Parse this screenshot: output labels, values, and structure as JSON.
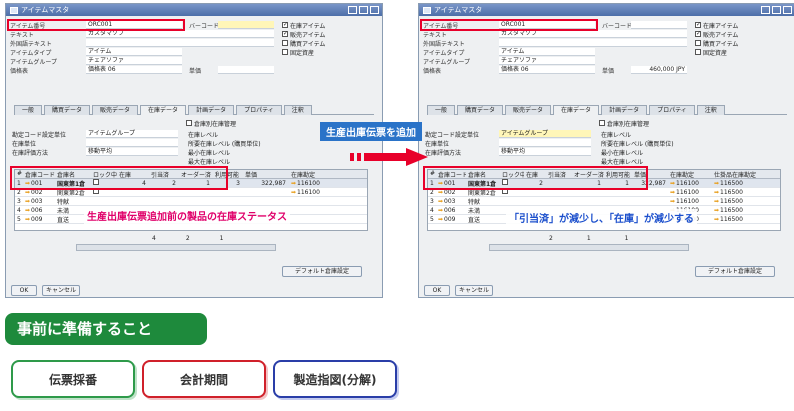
{
  "window_title": "アイテムマスタ",
  "fields": {
    "item_no_label": "アイテム番号",
    "item_no_value": "ORC001",
    "desc_label": "テキスト",
    "desc_value": "カスタマソフ",
    "foreign_label": "外国語テキスト",
    "type_label": "アイテムタイプ",
    "type_value": "アイテム",
    "group_label": "アイテムグループ",
    "group_value": "チェアソファ",
    "price_label": "価格表",
    "price_value": "価格表 06",
    "unit_price_label": "単価",
    "unit_price_value_right": "460,000 JPY",
    "barcode_label": "バーコード"
  },
  "checks": [
    "在庫アイテム",
    "販売アイテム",
    "購買アイテム",
    "固定資産"
  ],
  "tabs": [
    "一般",
    "購買データ",
    "販売データ",
    "在庫データ",
    "計画データ",
    "プロパティ",
    "注釈"
  ],
  "inventory": {
    "warehouse_mgmt": "倉庫別在庫管理",
    "method_label": "勘定コード設定単位",
    "method_value": "アイテムグループ",
    "unit_label": "在庫単位",
    "valuation_label": "在庫評価方法",
    "valuation_value": "移動平均",
    "stock_level": "在庫レベル",
    "required_level": "所要在庫レベル (購買単位)",
    "min_level": "最小在庫レベル",
    "max_level": "最大在庫レベル"
  },
  "grid_left": {
    "headers": [
      "#",
      "倉庫コード",
      "倉庫名",
      "ロック中",
      "在庫",
      "引当済",
      "オーダー済",
      "利用可能",
      "",
      "単価",
      "在庫勘定"
    ],
    "rows": [
      [
        "1",
        "001",
        "国東第1倉",
        "",
        "4",
        "2",
        "1",
        "3",
        "",
        "322,987",
        "116100"
      ],
      [
        "2",
        "002",
        "関東第2倉",
        "",
        "",
        "",
        "",
        "",
        "",
        "",
        "116100"
      ],
      [
        "3",
        "003",
        "特献",
        "",
        "",
        "",
        "",
        "",
        "",
        "",
        ""
      ],
      [
        "4",
        "006",
        "未満",
        "",
        "",
        "",
        "",
        "",
        "",
        "",
        ""
      ],
      [
        "5",
        "009",
        "直送",
        "",
        "",
        "",
        "",
        "",
        "",
        "",
        ""
      ]
    ],
    "footer_values": [
      "4",
      "2",
      "1"
    ]
  },
  "grid_right": {
    "headers": [
      "#",
      "倉庫コード",
      "倉庫名",
      "ロック中",
      "在庫",
      "引当済",
      "オーダー済",
      "利用可能",
      "単価",
      "在庫勘定",
      "仕掛品在庫勘定"
    ],
    "rows": [
      [
        "1",
        "001",
        "国東第1倉",
        "",
        "2",
        "",
        "1",
        "1",
        "322,987",
        "116100",
        "116500"
      ],
      [
        "2",
        "002",
        "関東第2倉",
        "",
        "",
        "",
        "",
        "",
        "",
        "116100",
        "116500"
      ],
      [
        "3",
        "003",
        "特献",
        "",
        "",
        "",
        "",
        "",
        "",
        "116100",
        "116500"
      ],
      [
        "4",
        "006",
        "未満",
        "",
        "",
        "",
        "",
        "",
        "",
        "116100",
        "116500"
      ],
      [
        "5",
        "009",
        "直送",
        "",
        "",
        "",
        "",
        "",
        "",
        "116100",
        "116500"
      ]
    ],
    "footer_values": [
      "2",
      "1",
      "1"
    ]
  },
  "buttons": {
    "default_wh": "デフォルト倉庫設定",
    "ok": "OK",
    "cancel": "キャンセル"
  },
  "callouts": {
    "add_slip": "生産出庫伝票を追加",
    "before_status": "生産出庫伝票追加前の製品の在庫ステータス",
    "after_status": "「引当済」が減少し、「在庫」が減少する"
  },
  "prep_title": "事前に準備すること",
  "pills": [
    "伝票採番",
    "会計期間",
    "製造指図(分解)"
  ],
  "colors": {
    "red": "#e8002a",
    "green": "#1e8a3c",
    "blue": "#2a73c8"
  }
}
